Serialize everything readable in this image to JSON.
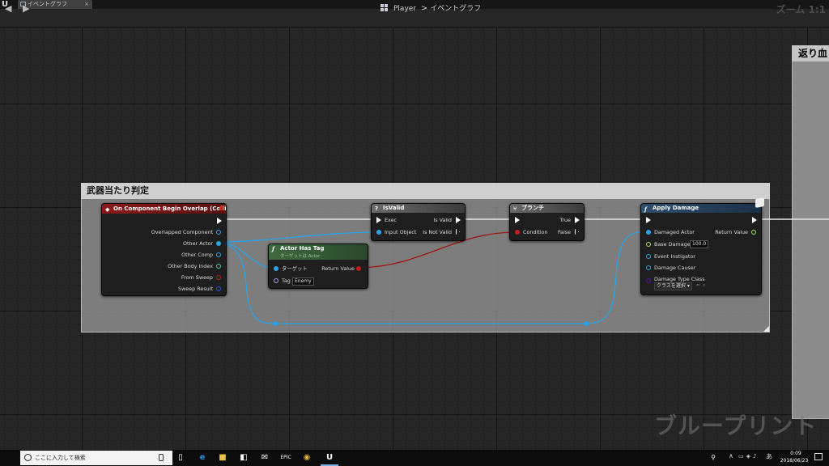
{
  "app": {
    "tab_title": "イベントグラフ",
    "tab_close": "×",
    "breadcrumb": {
      "blueprint": "Player",
      "separator": ">",
      "graph": "イベントグラフ"
    },
    "zoom_label": "ズーム 1:1",
    "watermark": "ブループリント"
  },
  "comments": {
    "main_title": "武器当たり判定",
    "right_title": "返り血"
  },
  "nodes": {
    "begin_overlap": {
      "title": "On Component Begin Overlap (Collision)",
      "header_color": "#8a1a1a",
      "outputs": [
        "Overlapped Component",
        "Other Actor",
        "Other Comp",
        "Other Body Index",
        "From Sweep",
        "Sweep Result"
      ]
    },
    "actor_has_tag": {
      "title": "Actor Has Tag",
      "subtitle": "ターゲットは Actor",
      "header_color": "#3f6b3f",
      "target_label": "ターゲット",
      "tag_label": "Tag",
      "tag_value": "Enemy",
      "return_label": "Return Value"
    },
    "is_valid": {
      "title": "IsValid",
      "header_color": "#5a5a5a",
      "exec_label": "Exec",
      "input_label": "Input Object",
      "valid_label": "Is Valid",
      "not_valid_label": "Is Not Valid"
    },
    "branch": {
      "title": "ブランチ",
      "header_color": "#5a5a5a",
      "condition_label": "Condition",
      "true_label": "True",
      "false_label": "False"
    },
    "apply_damage": {
      "title": "Apply Damage",
      "header_color": "#2e4e6e",
      "damaged_actor_label": "Damaged Actor",
      "base_damage_label": "Base Damage",
      "base_damage_value": "100.0",
      "event_instigator_label": "Event Instigator",
      "damage_causer_label": "Damage Causer",
      "damage_type_label": "Damage Type Class",
      "damage_type_value": "クラスを選択",
      "return_label": "Return Value"
    }
  },
  "colors": {
    "exec": "#ffffff",
    "object_pin": "#2aa3e8",
    "bool_pin": "#a11414",
    "int_pin": "#2fd9a6",
    "float_pin": "#a6e05c",
    "struct_pin": "#1d5bd8",
    "class_pin": "#5b10b0",
    "name_pin": "#b19cf0"
  },
  "taskbar": {
    "search_placeholder": "ここに入力して検索",
    "time": "0:09",
    "date": "2018/06/23",
    "ime": "あ"
  }
}
